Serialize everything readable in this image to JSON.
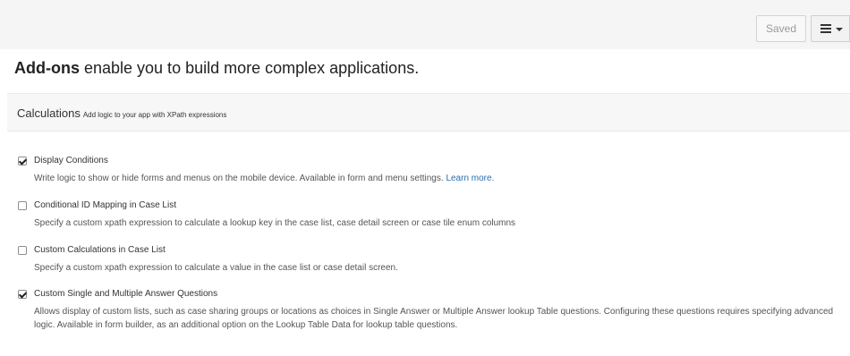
{
  "header": {
    "saved_label": "Saved"
  },
  "intro": {
    "bold": "Add-ons",
    "rest": " enable you to build more complex applications."
  },
  "panel": {
    "title": "Calculations",
    "subtitle": "Add logic to your app with XPath expressions"
  },
  "addons": [
    {
      "label": "Display Conditions",
      "checked": true,
      "description": "Write logic to show or hide forms and menus on the mobile device. Available in form and menu settings. ",
      "link": "Learn more."
    },
    {
      "label": "Conditional ID Mapping in Case List",
      "checked": false,
      "description": "Specify a custom xpath expression to calculate a lookup key in the case list, case detail screen or case tile enum columns"
    },
    {
      "label": "Custom Calculations in Case List",
      "checked": false,
      "description": "Specify a custom xpath expression to calculate a value in the case list or case detail screen."
    },
    {
      "label": "Custom Single and Multiple Answer Questions",
      "checked": true,
      "description": "Allows display of custom lists, such as case sharing groups or locations as choices in Single Answer or Multiple Answer lookup Table questions. Configuring these questions requires specifying advanced logic. Available in form builder, as an additional option on the Lookup Table Data for lookup table questions."
    }
  ],
  "icons": {
    "menu": "hamburger-menu-icon",
    "caret": "caret-down-icon",
    "checkbox": "checkbox-icon"
  }
}
